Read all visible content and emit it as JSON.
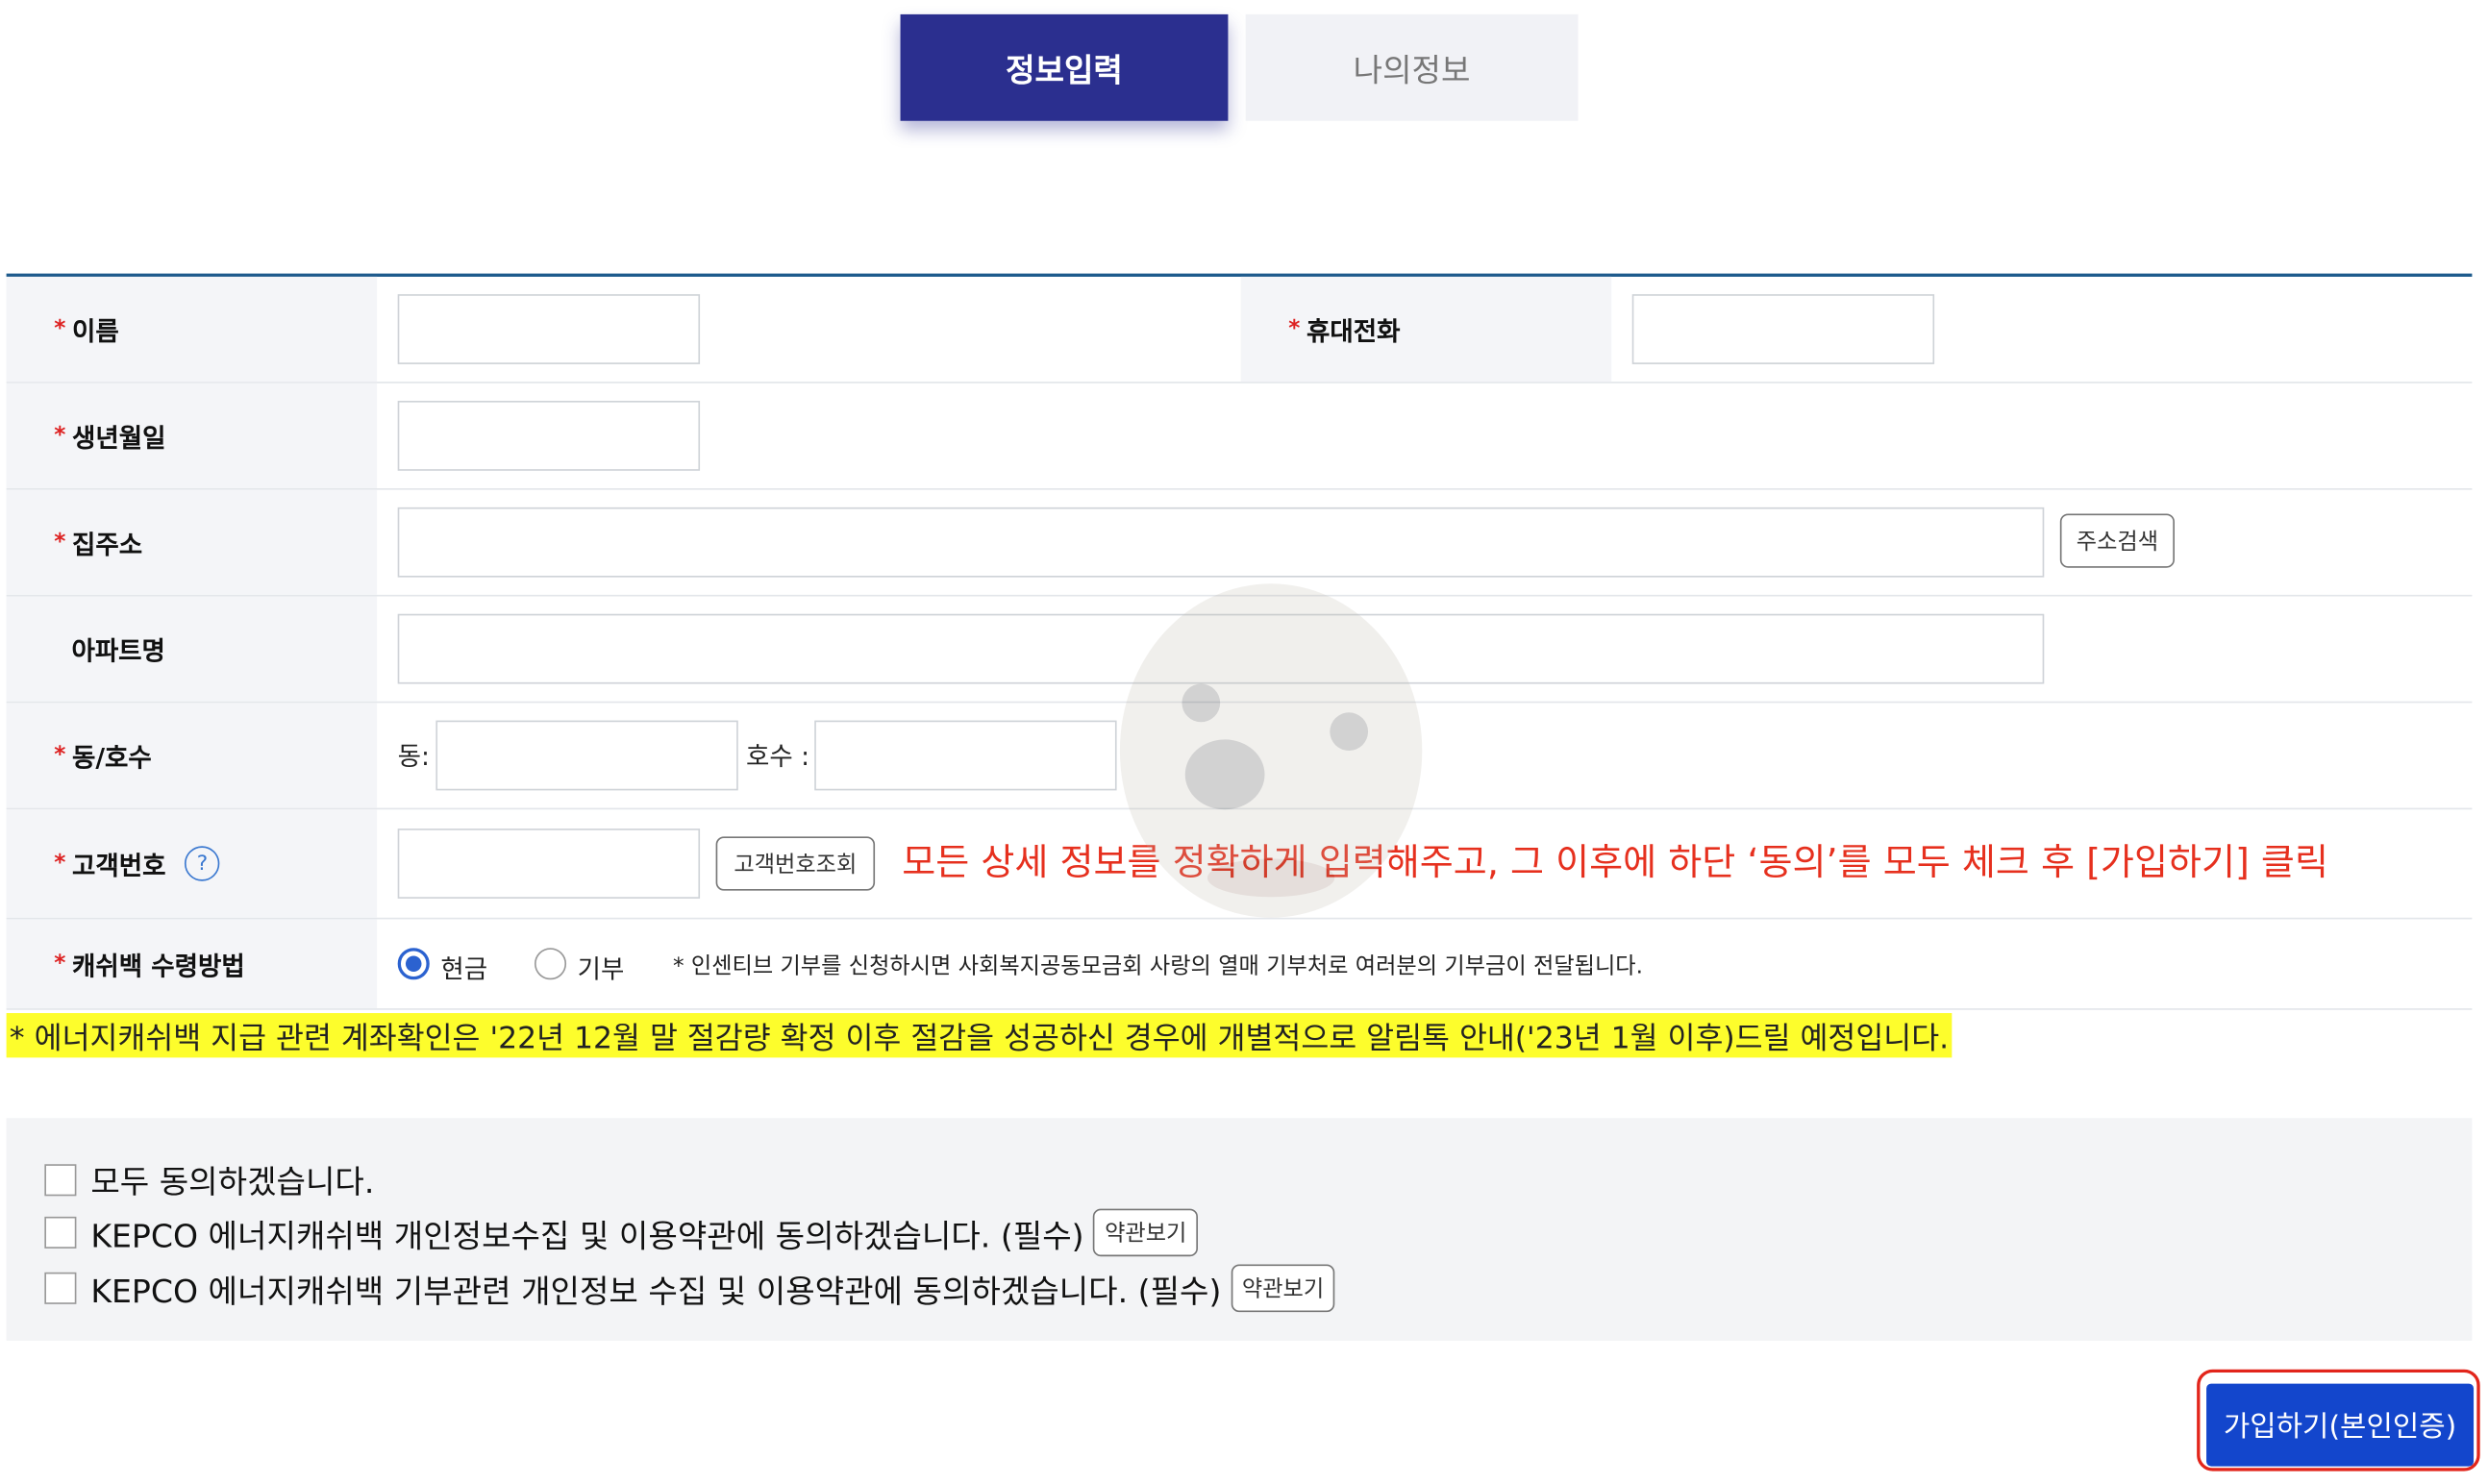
{
  "tabs": {
    "active": "정보입력",
    "inactive": "나의정보"
  },
  "form": {
    "required_mark": "*",
    "name_label": "이름",
    "phone_label": "휴대전화",
    "birth_label": "생년월일",
    "address_label": "집주소",
    "address_search_button": "주소검색",
    "apt_label": "아파트명",
    "dongho_label": "동/호수",
    "dong_prefix": "동:",
    "ho_prefix": "호수 :",
    "customer_no_label": "고객번호",
    "customer_help": "?",
    "customer_lookup_button": "고객번호조회",
    "cashback_label": "캐쉬백 수령방법",
    "cashback_options": [
      "현금",
      "기부"
    ],
    "cashback_selected": "현금",
    "cashback_note": "* 인센티브 기부를 신청하시면 사회복지공동모금회 사랑의 열매 기부처로 여러분의 기부금이 전달됩니다."
  },
  "annotation": "모든 상세 정보를 정확하게 입력해주고, 그 이후에 하단 ‘동의’를 모두 체크 후 [가입하기] 클릭",
  "notice": "* 에너지캐쉬백 지급 관련 계좌확인은 '22년 12월 말 절감량 확정 이후 절감을 성공하신 경우에 개별적으로 알림톡 안내('23년 1월 이후)드릴 예정입니다.",
  "agreements": {
    "all": "모두 동의하겠습니다.",
    "privacy": "KEPCO 에너지캐쉬백 개인정보수집 및 이용약관에 동의하겠습니다. (필수)",
    "donation": "KEPCO 에너지캐쉬백 기부관련 개인정보 수집 및 이용약관에 동의하겠습니다. (필수)",
    "terms_button": "약관보기"
  },
  "submit_button": "가입하기(본인인증)",
  "colors": {
    "tab_active": "#2b2f8f",
    "submit": "#1346cc",
    "highlight": "#fdfd2c",
    "annotation": "#e6301e"
  }
}
